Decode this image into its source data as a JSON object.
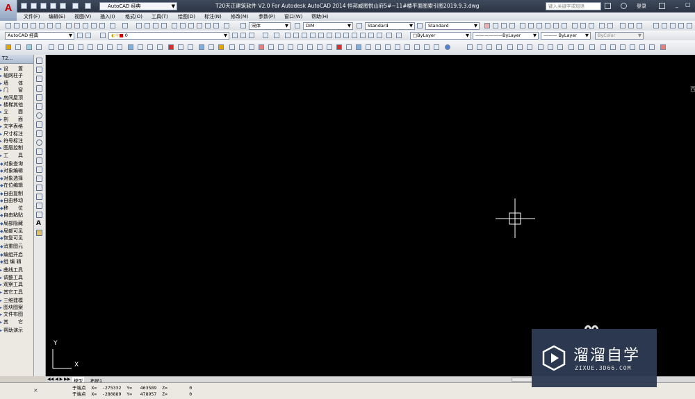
{
  "title_bar": {
    "workspace": "AutoCAD 经典",
    "window_title": "T20天正建筑软件 V2.0 For Autodesk AutoCAD 2014    恒邦威图悦山府5#~11#楼平面图索引图2019.9.3.dwg",
    "search_placeholder": "键入关键字或短语",
    "login_label": "登录"
  },
  "menu": [
    "文件(F)",
    "编辑(E)",
    "视图(V)",
    "插入(I)",
    "格式(O)",
    "工具(T)",
    "绘图(D)",
    "标注(N)",
    "修改(M)",
    "参数(P)",
    "窗口(W)",
    "帮助(H)"
  ],
  "toolbar": {
    "workspace_combo": "AutoCAD 经典",
    "layer_combo": "0",
    "text_style": "宋体",
    "dim_style": "DIM",
    "table_style": "Standard",
    "multileader_style": "Standard",
    "color_combo": "ByLayer",
    "linetype_combo": "ByLayer",
    "lineweight_combo": "ByLayer",
    "plotstyle_combo": "ByColor"
  },
  "palette": {
    "title": "T2...",
    "items": [
      "设　　置",
      "轴网柱子",
      "墙　　体",
      "门　　窗",
      "房间屋顶",
      "楼梯其他",
      "立　　面",
      "剖　　面",
      "文字表格",
      "尺寸标注",
      "符号标注",
      "图层控制",
      "工　　具",
      "对象查询",
      "对象编辑",
      "对象选择",
      "在位编辑",
      "自由复制",
      "自由移动",
      "移　　位",
      "自由粘贴",
      "局部隐藏",
      "局部可见",
      "恢复可见",
      "消重图元",
      "编组开启",
      "组 编 辑",
      "曲线工具",
      "调整工具",
      "观察工具",
      "其它工具",
      "三维建模",
      "图块图案",
      "文件布图",
      "其　　它",
      "帮助演示"
    ]
  },
  "layout_tabs": [
    "模型",
    "布局1"
  ],
  "ucs": {
    "x": "X",
    "y": "Y"
  },
  "command_lines": [
    "于端点  X=  -275332  Y=   463589  Z=        0",
    "于端点  X=  -280889  Y=   478957  Z=        0"
  ],
  "watermark": {
    "brand": "溜溜自学",
    "url": "ZIXUE.3D66.COM"
  },
  "colors": {
    "canvas": "#000000",
    "crosshair": "#ffffff",
    "accent_red": "#cc0000",
    "watermark_bg": "#2d3a52"
  }
}
